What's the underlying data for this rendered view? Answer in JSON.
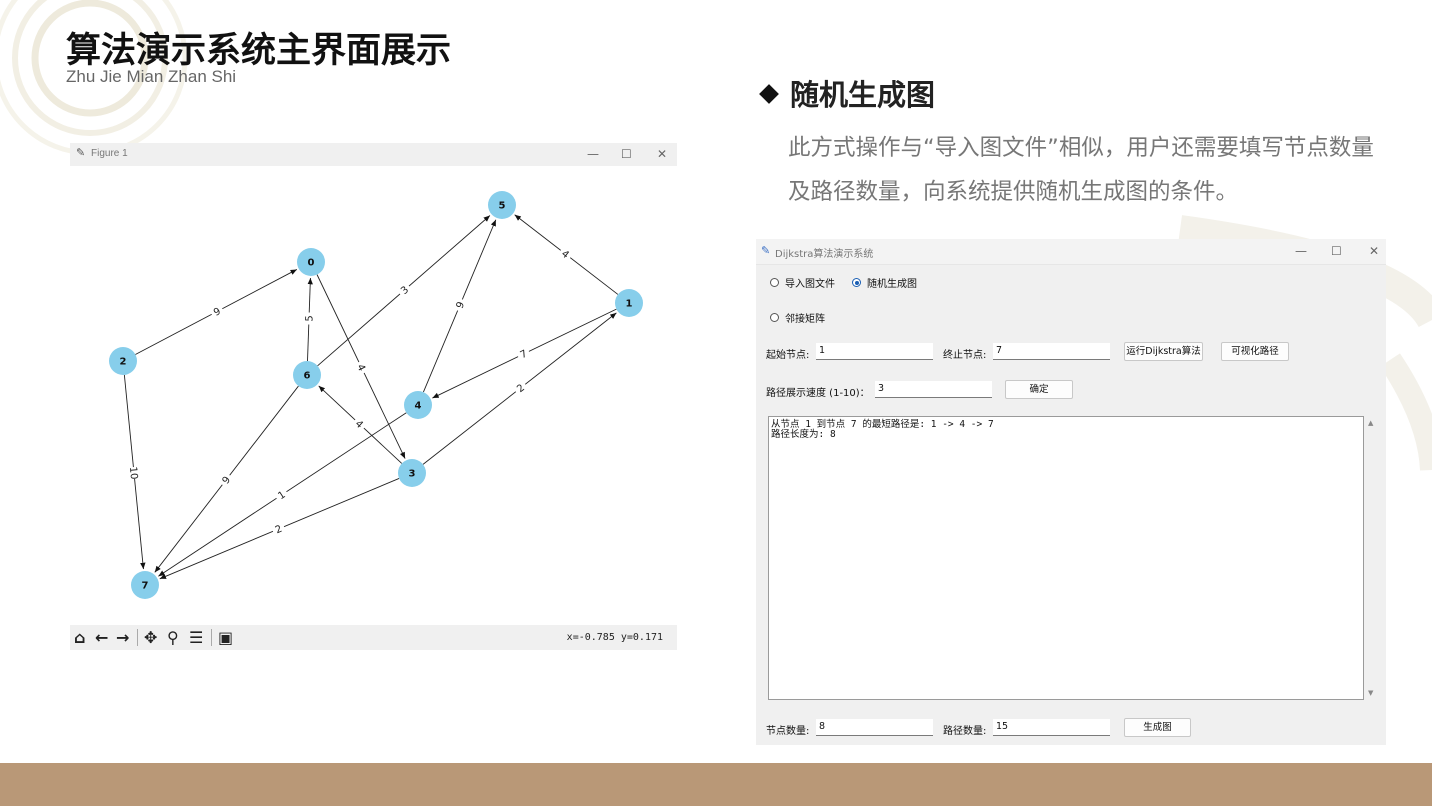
{
  "slide": {
    "title": "算法演示系统主界面展示",
    "subtitle": "Zhu Jie Mian Zhan Shi"
  },
  "figure_window": {
    "title": "Figure 1",
    "coords_readout": "x=-0.785 y=0.171",
    "node_color": "#87ceeb"
  },
  "graph": {
    "nodes": [
      "0",
      "1",
      "2",
      "3",
      "4",
      "5",
      "6",
      "7"
    ],
    "edges": [
      {
        "from": "2",
        "to": "0",
        "weight": "9"
      },
      {
        "from": "2",
        "to": "7",
        "weight": "10"
      },
      {
        "from": "6",
        "to": "0",
        "weight": "5"
      },
      {
        "from": "0",
        "to": "3",
        "weight": "4"
      },
      {
        "from": "6",
        "to": "5",
        "weight": "3"
      },
      {
        "from": "4",
        "to": "5",
        "weight": "9"
      },
      {
        "from": "1",
        "to": "5",
        "weight": "4"
      },
      {
        "from": "1",
        "to": "4",
        "weight": "7"
      },
      {
        "from": "3",
        "to": "1",
        "weight": "2"
      },
      {
        "from": "3",
        "to": "6",
        "weight": "4"
      },
      {
        "from": "6",
        "to": "7",
        "weight": "9"
      },
      {
        "from": "4",
        "to": "7",
        "weight": "1"
      },
      {
        "from": "3",
        "to": "7",
        "weight": "2"
      }
    ]
  },
  "section": {
    "heading": "随机生成图",
    "description": "此方式操作与“导入图文件”相似，用户还需要填写节点数量及路径数量，向系统提供随机生成图的条件。"
  },
  "app": {
    "title": "Dijkstra算法演示系统",
    "radio_import": "导入图文件",
    "radio_random": "随机生成图",
    "radio_adjacency": "邻接矩阵",
    "selected_mode": "随机生成图",
    "start_label": "起始节点:",
    "start_value": "1",
    "end_label": "终止节点:",
    "end_value": "7",
    "run_button": "运行Dijkstra算法",
    "visualize_button": "可视化路径",
    "speed_label": "路径展示速度 (1-10)：",
    "speed_value": "3",
    "confirm_button": "确定",
    "output_lines": [
      "从节点 1 到节点 7 的最短路径是: 1 -> 4 -> 7",
      "路径长度为: 8"
    ],
    "node_count_label": "节点数量:",
    "node_count_value": "8",
    "edge_count_label": "路径数量:",
    "edge_count_value": "15",
    "generate_button": "生成图"
  },
  "colors": {
    "bottom_band": "#b99877",
    "radio_selected": "#1a5fb4"
  }
}
